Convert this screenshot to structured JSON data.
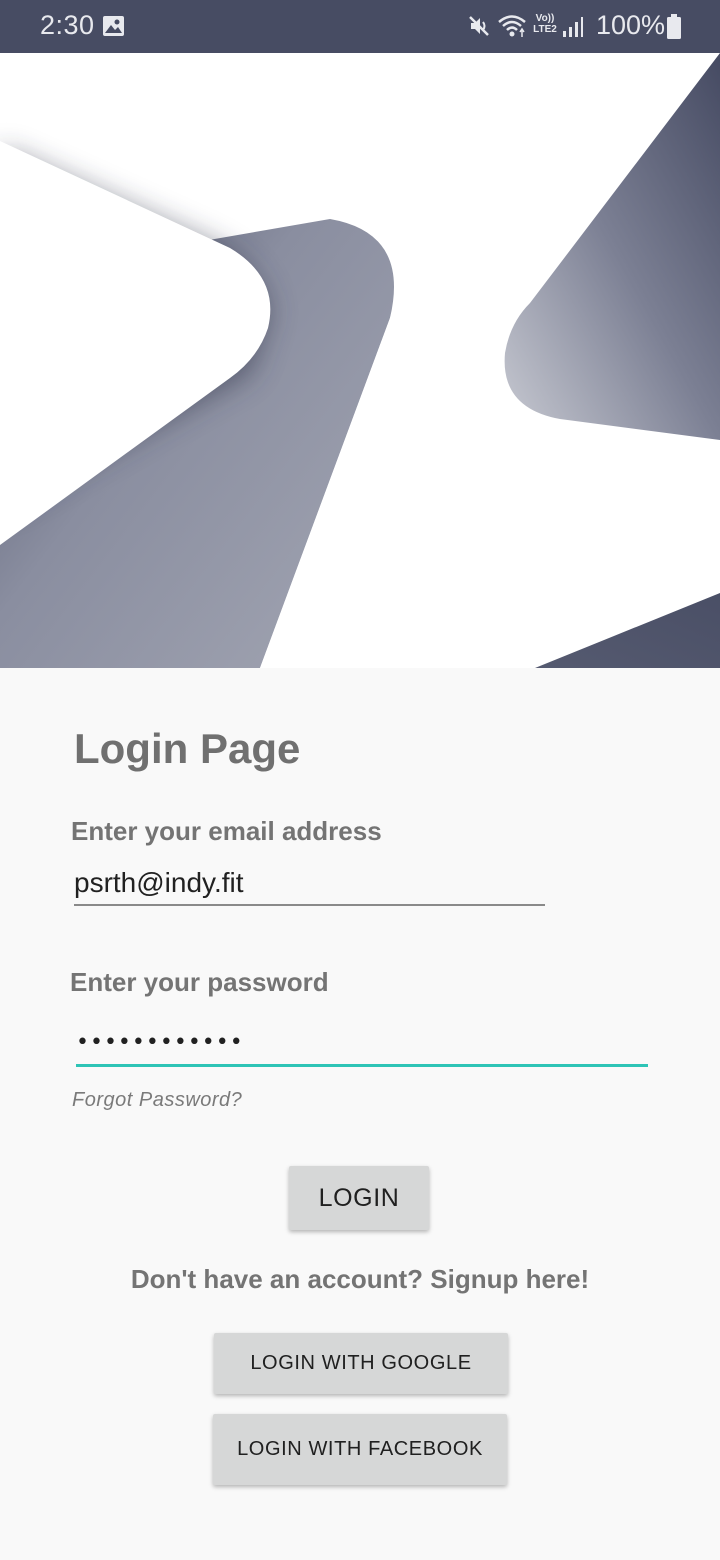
{
  "status_bar": {
    "time": "2:30",
    "volte_line1": "Vo))",
    "volte_line2": "LTE2",
    "battery": "100%"
  },
  "login": {
    "title": "Login Page",
    "email_label": "Enter your email address",
    "email_value": "psrth@indy.fit",
    "password_label": "Enter your password",
    "password_value": "••••••••••••",
    "forgot_password": "Forgot Password?",
    "login_button": "LOGIN",
    "signup_text": "Don't have an account? Signup here!",
    "google_button": "LOGIN WITH GOOGLE",
    "facebook_button": "LOGIN WITH FACEBOOK"
  },
  "colors": {
    "status_bar": "#474c63",
    "accent_underline": "#2ec4b6",
    "button_bg": "#d6d7d7"
  }
}
